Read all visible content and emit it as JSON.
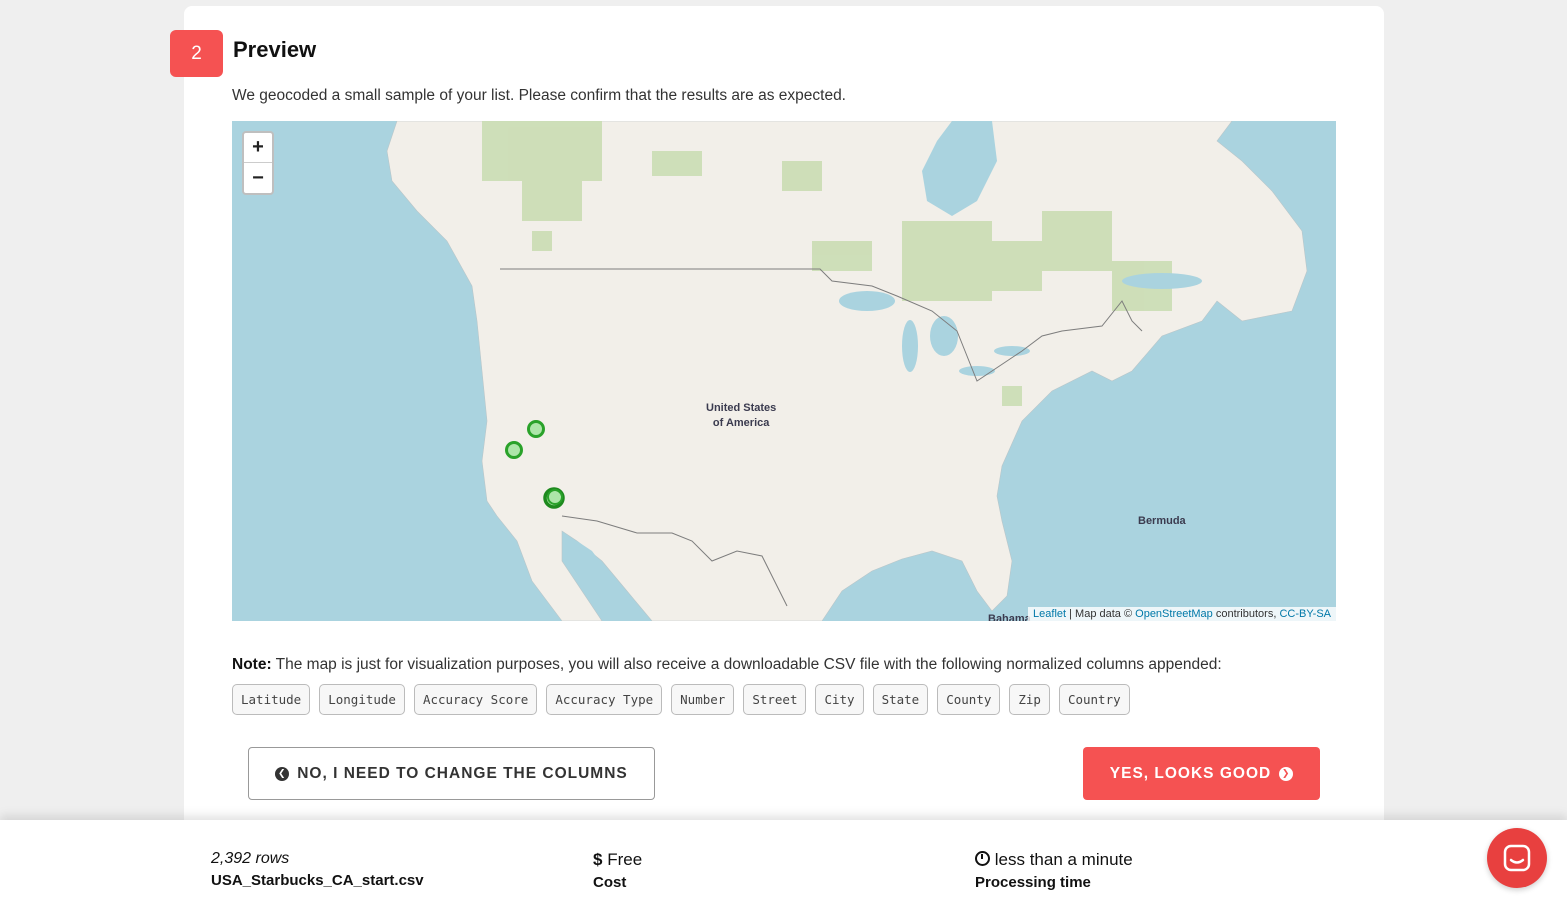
{
  "step": {
    "number": "2",
    "title": "Preview",
    "subtitle": "We geocoded a small sample of your list. Please confirm that the results are as expected."
  },
  "map": {
    "zoom_in": "+",
    "zoom_out": "−",
    "labels": {
      "usa_line1": "United States",
      "usa_line2": "of America",
      "bermuda": "Bermuda",
      "bahamas": "Bahama"
    },
    "attribution": {
      "leaflet": "Leaflet",
      "sep": " | Map data © ",
      "osm": "OpenStreetMap",
      "contributors": " contributors, ",
      "license": "CC-BY-SA"
    },
    "colors": {
      "water": "#aad3df",
      "land": "#f2efe9",
      "forest": "#c8dcb0",
      "marker": "#2aa22a"
    }
  },
  "note": {
    "label": "Note:",
    "text": " The map is just for visualization purposes, you will also receive a downloadable CSV file with the following normalized columns appended:"
  },
  "columns": [
    "Latitude",
    "Longitude",
    "Accuracy Score",
    "Accuracy Type",
    "Number",
    "Street",
    "City",
    "State",
    "County",
    "Zip",
    "Country"
  ],
  "buttons": {
    "no": "NO, I NEED TO CHANGE THE COLUMNS",
    "yes": "YES, LOOKS GOOD"
  },
  "footer": {
    "rows_value": "2,392 rows",
    "filename": "USA_Starbucks_CA_start.csv",
    "cost_value": "Free",
    "cost_label": "Cost",
    "time_value": "less than a minute",
    "time_label": "Processing time"
  },
  "accent_color": "#f55252"
}
